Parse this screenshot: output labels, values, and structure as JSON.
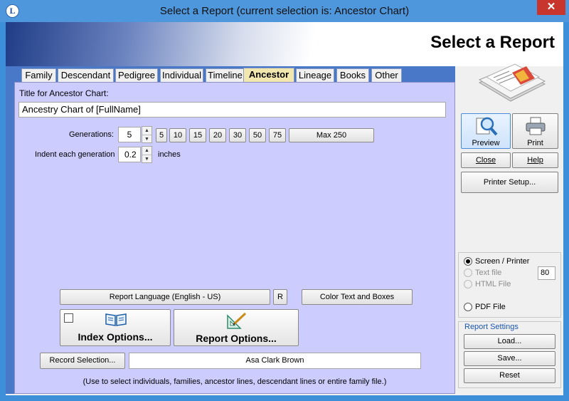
{
  "window": {
    "app_icon": "L",
    "title": "Select a Report  (current selection is: Ancestor Chart)",
    "close_glyph": "✕"
  },
  "banner": {
    "title": "Select a Report"
  },
  "tabs": [
    {
      "label": "Family"
    },
    {
      "label": "Descendant"
    },
    {
      "label": "Pedigree"
    },
    {
      "label": "Individual"
    },
    {
      "label": "Timeline"
    },
    {
      "label": "Ancestor"
    },
    {
      "label": "Lineage"
    },
    {
      "label": "Books"
    },
    {
      "label": "Other"
    }
  ],
  "form": {
    "title_label": "Title for Ancestor Chart:",
    "title_value": "Ancestry Chart of [FullName]",
    "generations_label": "Generations:",
    "generations_value": "5",
    "generation_presets": [
      "5",
      "10",
      "15",
      "20",
      "30",
      "50",
      "75"
    ],
    "max_button": "Max 250",
    "indent_label": "Indent each generation",
    "indent_value": "0.2",
    "indent_unit": "inches"
  },
  "bottom": {
    "report_language": "Report Language (English - US)",
    "r_button": "R",
    "color_button": "Color Text and Boxes",
    "index_options": "Index Options...",
    "report_options": "Report Options...",
    "record_selection": "Record Selection...",
    "selected_person": "Asa Clark Brown",
    "hint": "(Use to select individuals, families, ancestor lines, descendant lines or entire family file.)"
  },
  "sidebar": {
    "preview": "Preview",
    "print": "Print",
    "close": "Close",
    "help": "Help",
    "printer_setup": "Printer Setup...",
    "output": {
      "screen_printer": "Screen / Printer",
      "text_file": "Text file",
      "html_file": "HTML File",
      "pdf_file": "PDF File",
      "width_value": "80",
      "selected": "Screen / Printer"
    },
    "report_settings": {
      "title": "Report Settings",
      "load": "Load...",
      "save": "Save...",
      "reset": "Reset"
    }
  },
  "colors": {
    "title_bar": "#4f97dc",
    "panel": "#ccccff",
    "active_tab": "#f3e7b0",
    "close_red": "#c7352c"
  }
}
